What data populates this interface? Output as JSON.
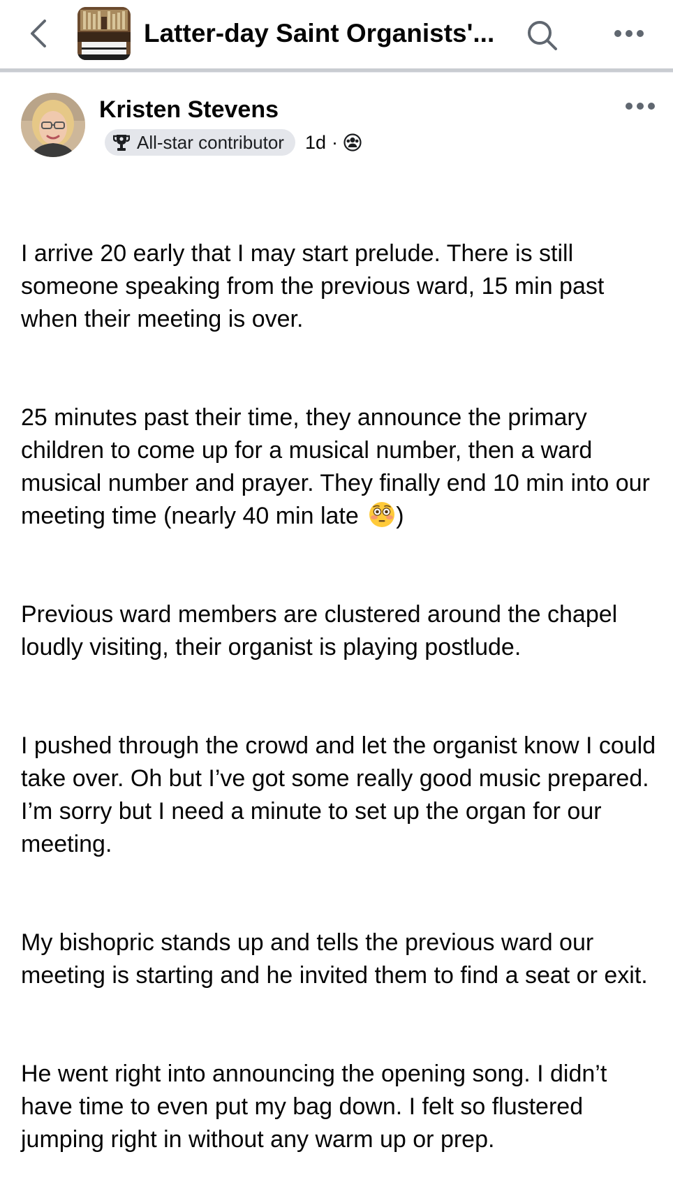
{
  "header": {
    "group_title": "Latter-day Saint Organists'...",
    "icons": {
      "back": "chevron-left-icon",
      "search": "search-icon",
      "more": "more-horizontal-icon"
    }
  },
  "post": {
    "author": "Kristen Stevens",
    "badge": "All-star contributor",
    "time": "1d",
    "separator": "·",
    "audience_icon": "group-privacy-icon",
    "paragraphs": [
      "I arrive 20 early that I may start prelude. There is still someone speaking from the previous ward, 15 min past when their meeting is over.",
      "25 minutes past their time, they announce the primary children to come up for a musical number, then a ward musical number and prayer. They finally end 10 min into our meeting time (nearly 40 min late ",
      "Previous ward members are clustered around the chapel loudly visiting, their organist is playing postlude.",
      "I pushed through the crowd and let the organist know I could take over. Oh but I’ve got some really good music prepared. I’m sorry but I need a minute to set up the organ for our meeting.",
      "My bishopric stands up and tells the previous ward our meeting is starting and he invited them to find a seat or exit.",
      "He went right into announcing the opening song. I didn’t have time to even put my bag down. I felt so flustered jumping right in without any warm up or prep."
    ],
    "paragraph2_tail": ")",
    "emoji": "flushed-face-emoji"
  },
  "colors": {
    "text": "#050505",
    "badge_bg": "#e4e6eb",
    "divider": "#c9ccd1",
    "icon": "#606770"
  }
}
